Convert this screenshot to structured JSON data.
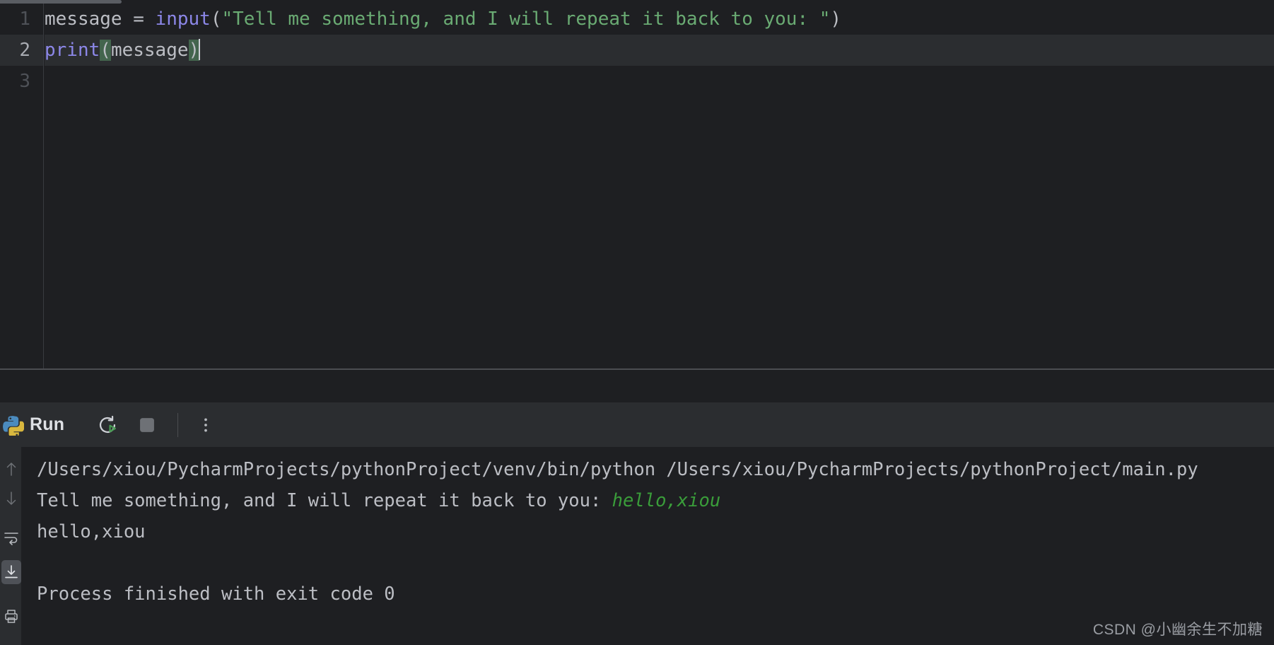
{
  "editor": {
    "lines": [
      {
        "number": "1",
        "current": false,
        "tokens": [
          {
            "text": "message ",
            "type": "default"
          },
          {
            "text": "= ",
            "type": "op"
          },
          {
            "text": "input",
            "type": "func"
          },
          {
            "text": "(",
            "type": "default"
          },
          {
            "text": "\"Tell me something, and I will repeat it back to you: \"",
            "type": "string"
          },
          {
            "text": ")",
            "type": "default"
          }
        ]
      },
      {
        "number": "2",
        "current": true,
        "tokens": [
          {
            "text": "print",
            "type": "func"
          },
          {
            "text": "(",
            "type": "brace"
          },
          {
            "text": "message",
            "type": "default"
          },
          {
            "text": ")",
            "type": "brace"
          }
        ]
      },
      {
        "number": "3",
        "current": false,
        "tokens": []
      }
    ]
  },
  "run_panel": {
    "title": "Run",
    "icons": {
      "app": "python-logo-icon",
      "rerun": "rerun-icon",
      "stop": "stop-icon",
      "more": "more-options-icon"
    },
    "gutter_icons": [
      {
        "name": "previous-occurrence-icon",
        "active": false
      },
      {
        "name": "next-occurrence-icon",
        "active": false
      },
      {
        "name": "soft-wrap-icon",
        "active": false
      },
      {
        "name": "scroll-to-end-icon",
        "active": true
      },
      {
        "name": "print-icon",
        "active": false
      }
    ]
  },
  "console": {
    "lines": [
      {
        "segments": [
          {
            "text": "/Users/xiou/PycharmProjects/pythonProject/venv/bin/python /Users/xiou/PycharmProjects/pythonProject/main.py",
            "type": "stdout"
          }
        ]
      },
      {
        "segments": [
          {
            "text": "Tell me something, and I will repeat it back to you: ",
            "type": "stdout"
          },
          {
            "text": "hello,xiou",
            "type": "user-input"
          }
        ]
      },
      {
        "segments": [
          {
            "text": "hello,xiou",
            "type": "stdout"
          }
        ]
      },
      {
        "segments": []
      },
      {
        "segments": [
          {
            "text": "Process finished with exit code 0",
            "type": "stdout"
          }
        ]
      }
    ]
  },
  "watermark": {
    "text": "CSDN @小幽余生不加糖"
  },
  "colors": {
    "editor_bg": "#1E1F22",
    "current_line_bg": "#2B2D30",
    "toolbar_bg": "#2B2D30",
    "string": "#6AAB73",
    "function": "#8C87E8",
    "default_text": "#BCBEC4",
    "brace_highlight": "#43654D",
    "user_input_green": "#3A9D3A",
    "run_green": "#499C54"
  }
}
